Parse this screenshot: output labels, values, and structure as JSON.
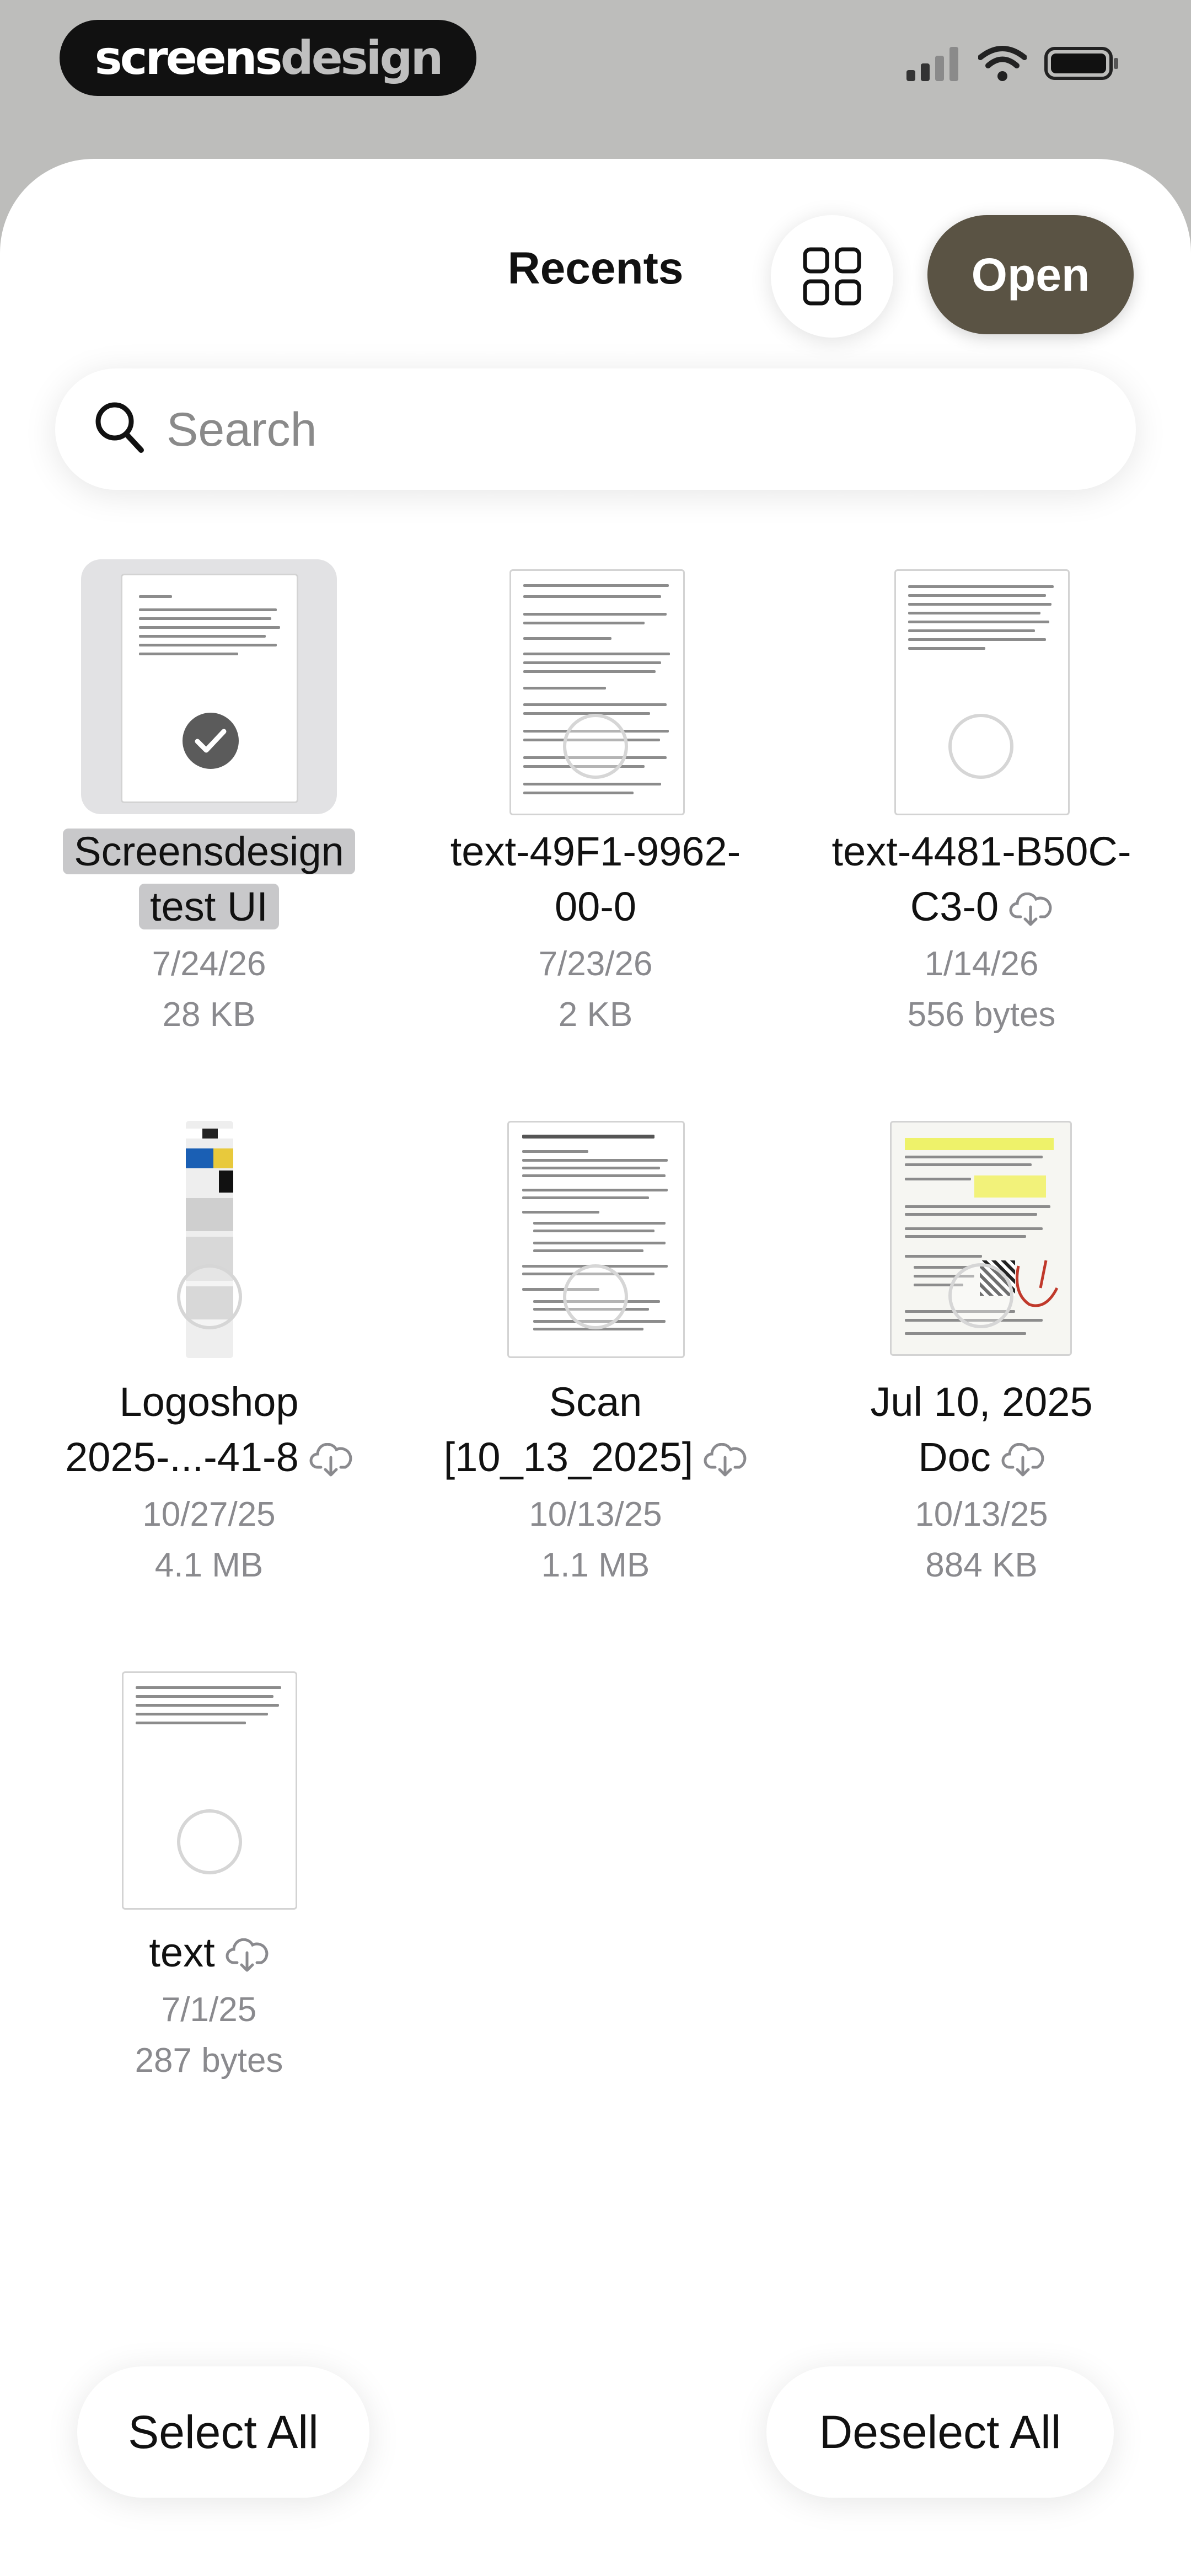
{
  "status_bar": {
    "brand_left": "screens",
    "brand_right": "design"
  },
  "header": {
    "title": "Recents",
    "open_label": "Open"
  },
  "search": {
    "placeholder": "Search"
  },
  "files": [
    {
      "name": "Screensdesign test UI",
      "name_line1": "Screensdesign",
      "name_line2": "test UI",
      "date": "7/24/26",
      "size": "28 KB",
      "selected": true,
      "in_cloud": false
    },
    {
      "name": "text-49F1-9962-00-0",
      "name_line1": "text-49F1-9962-",
      "name_line2": "00-0",
      "date": "7/23/26",
      "size": "2 KB",
      "selected": false,
      "in_cloud": false
    },
    {
      "name": "text-4481-B50C-C3-0",
      "name_line1": "text-4481-B50C-",
      "name_line2": "C3-0",
      "date": "1/14/26",
      "size": "556 bytes",
      "selected": false,
      "in_cloud": true
    },
    {
      "name": "Logoshop 2025-...-41-8",
      "name_line1": "Logoshop",
      "name_line2": "2025-...-41-8",
      "date": "10/27/25",
      "size": "4.1 MB",
      "selected": false,
      "in_cloud": true
    },
    {
      "name": "Scan [10_13_2025]",
      "name_line1": "Scan",
      "name_line2": "[10_13_2025]",
      "date": "10/13/25",
      "size": "1.1 MB",
      "selected": false,
      "in_cloud": true
    },
    {
      "name": "Jul 10, 2025 Doc",
      "name_line1": "Jul 10, 2025",
      "name_line2": "Doc",
      "date": "10/13/25",
      "size": "884 KB",
      "selected": false,
      "in_cloud": true
    },
    {
      "name": "text",
      "name_line1": "text",
      "name_line2": "",
      "date": "7/1/25",
      "size": "287 bytes",
      "selected": false,
      "in_cloud": true
    }
  ],
  "footer": {
    "select_all": "Select All",
    "deselect_all": "Deselect All"
  },
  "colors": {
    "open_button": "#5a5344",
    "sheet": "#ffffff",
    "backdrop": "#bdbdbb"
  }
}
